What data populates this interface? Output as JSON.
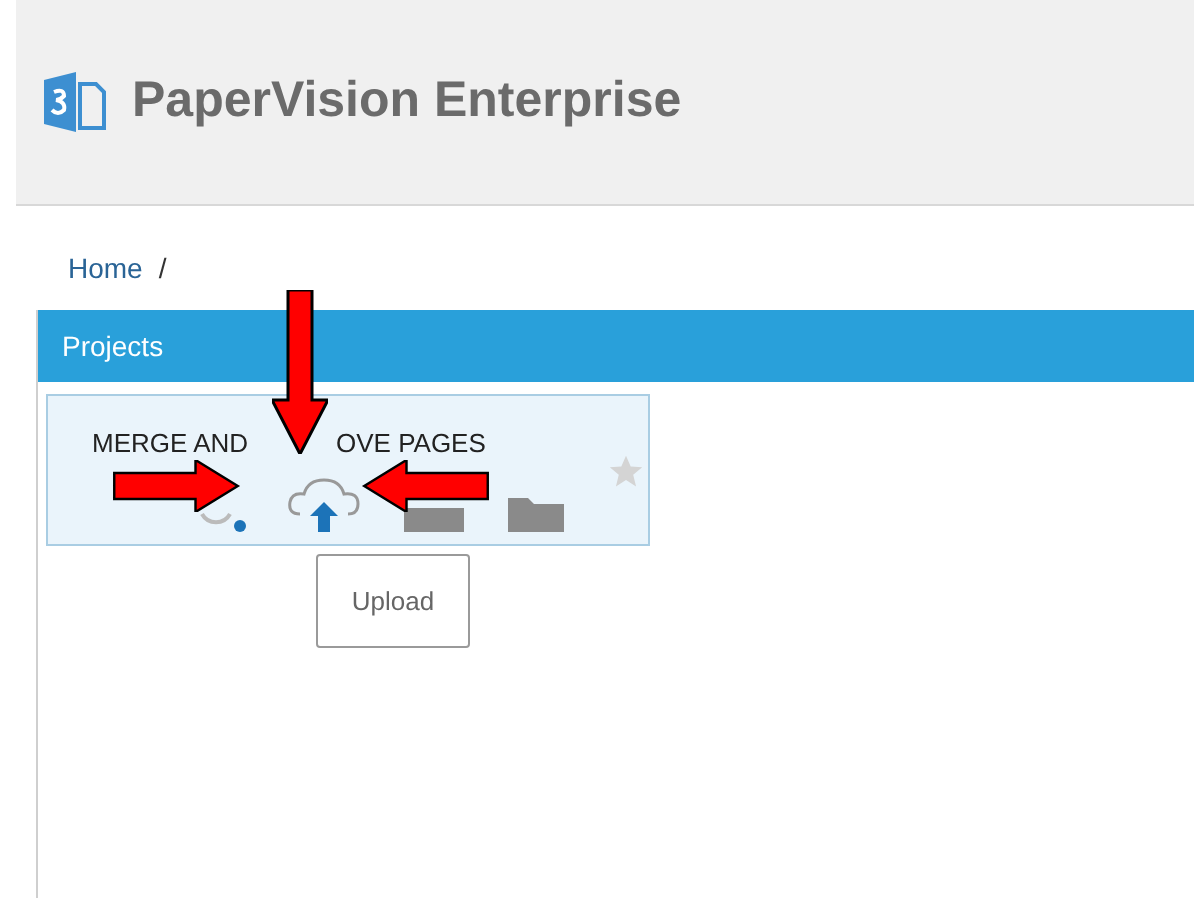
{
  "header": {
    "title": "PaperVision Enterprise"
  },
  "breadcrumb": [
    {
      "label": "Home",
      "separator": "/"
    }
  ],
  "panel": {
    "title": "Projects"
  },
  "projects": [
    {
      "name_parts": [
        "MERGE AND",
        "OVE PAGES"
      ],
      "tooltip": "Upload"
    }
  ]
}
